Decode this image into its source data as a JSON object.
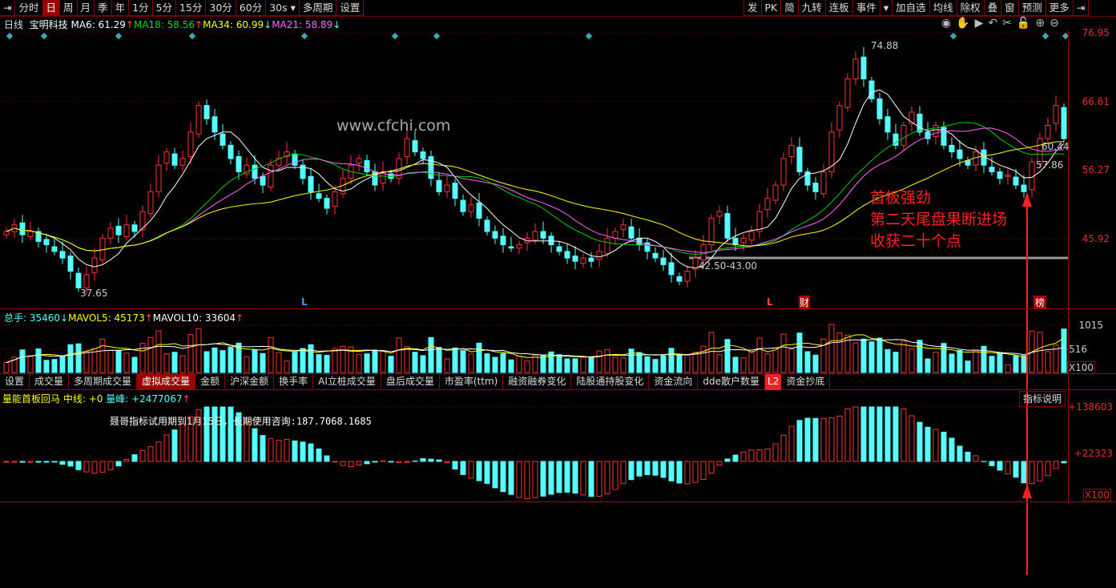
{
  "toolbar_left": [
    "分时",
    "日",
    "周",
    "月",
    "季",
    "年",
    "1分",
    "5分",
    "15分",
    "30分",
    "60分",
    "30s ▾",
    "多周期",
    "设置"
  ],
  "toolbar_active": "日",
  "toolbar_right": [
    "发",
    "PK",
    "简",
    "九转",
    "连板",
    "事件",
    "▾",
    "加自选",
    "均线",
    "除权",
    "叠",
    "窗",
    "预测",
    "更多"
  ],
  "header": {
    "period": "日线",
    "stock": "宝明科技",
    "ma6": "MA6: 61.29",
    "ma18": "MA18: 58.56",
    "ma34": "MA34: 60.99",
    "ma21": "MA21: 58.89"
  },
  "colors": {
    "up": "#ff3232",
    "down": "#54ffff",
    "ma6": "#ffffff",
    "ma18": "#00d000",
    "ma34": "#ffff00",
    "ma21": "#ff66ff",
    "annotation": "#ff2020"
  },
  "price_axis": [
    "76.95",
    "66.61",
    "56.27",
    "45.92"
  ],
  "chart_labels": {
    "high": "74.88",
    "low": "37.65",
    "support": "42.50-43.00",
    "p1": "60.44",
    "p2": "57.86",
    "watermark": "www.cfchi.com",
    "L1": "L",
    "L2": "L",
    "cai": "财",
    "bang": "榜"
  },
  "annotation": [
    "首板强劲",
    "第二天尾盘果断进场",
    "收获二十个点"
  ],
  "volume": {
    "total": "总手: 35460",
    "mavol5": "MAVOL5: 45173",
    "mavol10": "MAVOL10: 33604",
    "axis": [
      "1015",
      "516",
      "X100"
    ]
  },
  "tabs": [
    "设置",
    "成交量",
    "多周期成交量",
    "虚拟成交量",
    "金额",
    "沪深金额",
    "换手率",
    "AI立桩成交量",
    "盘后成交量",
    "市盈率(ttm)",
    "融资融券变化",
    "陆股通持股变化",
    "资金流向",
    "dde散户数量",
    "L2",
    "资金抄底"
  ],
  "tabs_active": "虚拟成交量",
  "indicator": {
    "name": "量能首板回马",
    "mid": "中线: +0",
    "peak": "量峰: +2477067",
    "notice": "聂哥指标试用期到1月15日，长期使用咨询:187.7068.1685",
    "help": "指标说明",
    "axis": [
      "+138603",
      "+22323",
      "X100"
    ]
  },
  "chart_data": {
    "type": "candlestick",
    "price_range": [
      37.65,
      76.95
    ],
    "closes": [
      47,
      48,
      46.5,
      47,
      45.5,
      45,
      44,
      43,
      41,
      38.5,
      40.5,
      43,
      46,
      47.5,
      46.5,
      48,
      47,
      50,
      53,
      57,
      59,
      57,
      58,
      62,
      66,
      64,
      62,
      60,
      58,
      56,
      57,
      55,
      54,
      57,
      58,
      59,
      57,
      55,
      53,
      52,
      50.5,
      53,
      55,
      57,
      58,
      56,
      54,
      56,
      55,
      58,
      61,
      59,
      58,
      55,
      53,
      54,
      52,
      50,
      51,
      49,
      47,
      46,
      45,
      44.5,
      45,
      46,
      47,
      46,
      45,
      44,
      43,
      42.5,
      43,
      42.5,
      44,
      46,
      47,
      48,
      46,
      45,
      44,
      43,
      42,
      40.5,
      39.5,
      41,
      43,
      45,
      49,
      50,
      46,
      45,
      46,
      47,
      50,
      52,
      54,
      58,
      60,
      56,
      54,
      53,
      56,
      62,
      66,
      70,
      73,
      70,
      67,
      64,
      62,
      60,
      63,
      65,
      62,
      61,
      63,
      60,
      59,
      58,
      57,
      59,
      57,
      56,
      55,
      55.5,
      54,
      53,
      57.5,
      61,
      63,
      66,
      61
    ]
  }
}
